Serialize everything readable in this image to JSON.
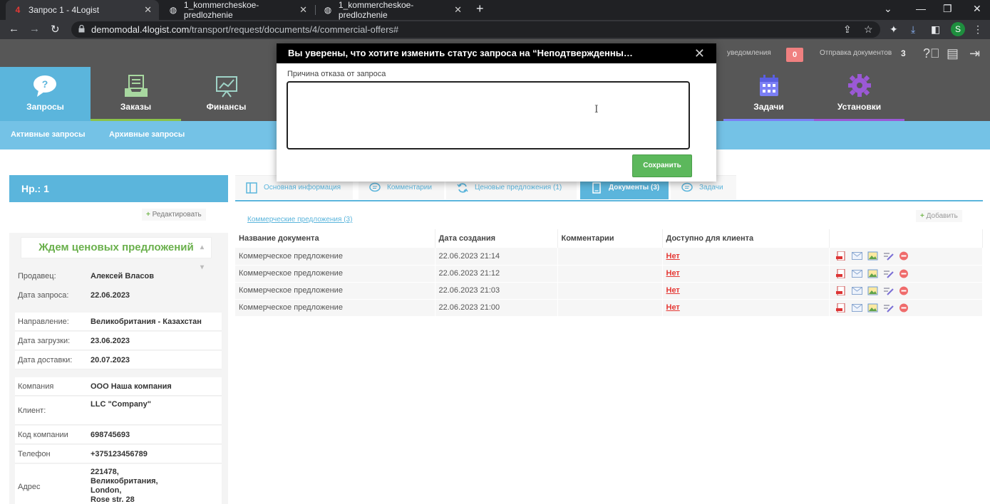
{
  "browser": {
    "tabs": [
      {
        "title": "Запрос 1 - 4Logist"
      },
      {
        "title": "1_kommercheskoe-predlozhenie"
      },
      {
        "title": "1_kommercheskoe-predlozhenie"
      }
    ],
    "url_host": "demomodal.4logist.com",
    "url_path": "/transport/request/documents/4/commercial-offers#",
    "profile_initial": "S"
  },
  "topbar": {
    "notifications_label": "уведомления",
    "notifications_count": "0",
    "doc_sending_label": "Отправка документов",
    "doc_sending_count": "3"
  },
  "mainnav": {
    "tabs": [
      {
        "label": "Запросы"
      },
      {
        "label": "Заказы"
      },
      {
        "label": "Финансы"
      },
      {
        "label": "Задачи"
      },
      {
        "label": "Установки"
      }
    ]
  },
  "subnav": {
    "active_requests": "Активные запросы",
    "archived_requests": "Архивные запросы"
  },
  "request": {
    "number_label": "Нр.: 1",
    "edit_label": "Редактировать",
    "status": "Ждем ценовых предложений",
    "fields": [
      {
        "label": "Продавец:",
        "value": "Алексей Власов"
      },
      {
        "label": "Дата запроса:",
        "value": "22.06.2023"
      },
      {
        "label": "Направление:",
        "value": "Великобритания - Казахстан"
      },
      {
        "label": "Дата загрузки:",
        "value": "23.06.2023"
      },
      {
        "label": "Дата доставки:",
        "value": "20.07.2023"
      },
      {
        "label": "Компания",
        "value": "ООО Наша компания"
      },
      {
        "label": "Клиент:",
        "value": "LLC \"Company\""
      },
      {
        "label": "Код компании",
        "value": "698745693"
      },
      {
        "label": "Телефон",
        "value": "+375123456789"
      },
      {
        "label": "Адрес",
        "value_lines": [
          "221478,",
          "Великобритания,",
          "London,",
          "Rose str. 28"
        ]
      }
    ]
  },
  "content": {
    "tabs": [
      {
        "label": "Основная информация"
      },
      {
        "label": "Комментарии"
      },
      {
        "label": "Ценовые предложения (1)"
      },
      {
        "label": "Документы (3)"
      },
      {
        "label": "Задачи"
      }
    ],
    "sublink": "Коммерческие предложения (3)",
    "add_label": "Добавить",
    "table": {
      "headers": [
        "Название документа",
        "Дата создания",
        "Комментарии",
        "Доступно для клиента",
        ""
      ],
      "rows": [
        {
          "name": "Коммерческое предложение",
          "date": "22.06.2023 21:14",
          "comment": "",
          "available": "Нет"
        },
        {
          "name": "Коммерческое предложение",
          "date": "22.06.2023 21:12",
          "comment": "",
          "available": "Нет"
        },
        {
          "name": "Коммерческое предложение",
          "date": "22.06.2023 21:03",
          "comment": "",
          "available": "Нет"
        },
        {
          "name": "Коммерческое предложение",
          "date": "22.06.2023 21:00",
          "comment": "",
          "available": "Нет"
        }
      ]
    }
  },
  "modal": {
    "title": "Вы уверены, что хотите изменить статус запроса на “Неподтвержденны…",
    "reason_label": "Причина отказа от запроса",
    "reason_value": "",
    "save_label": "Сохранить"
  },
  "colors": {
    "accent_blue": "#5bb5dc",
    "status_green": "#6ab04c",
    "save_green": "#5cb85c",
    "no_red": "#e53935"
  }
}
